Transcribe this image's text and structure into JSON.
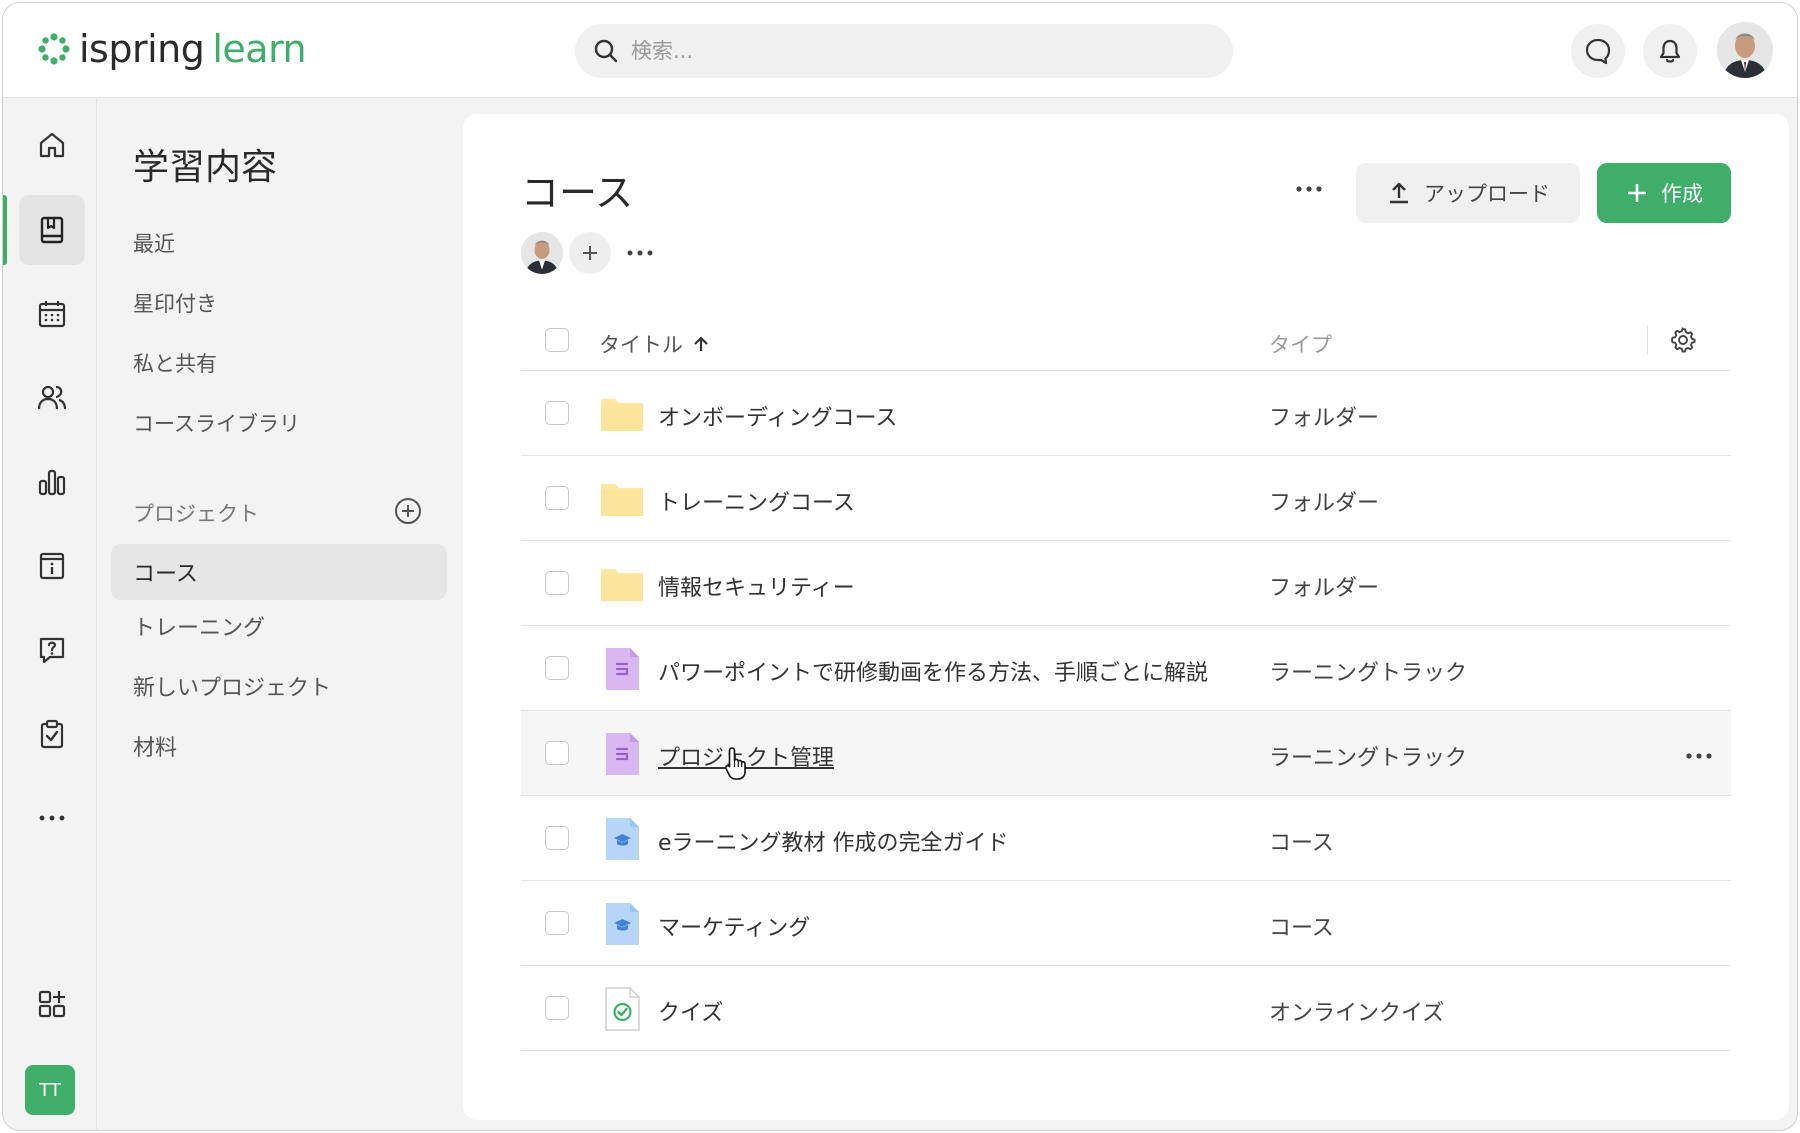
{
  "header": {
    "logo_primary": "ispring",
    "logo_secondary": "learn",
    "search_placeholder": "検索...",
    "colors": {
      "brand": "#3fae6b"
    }
  },
  "rail": {
    "items": [
      "home-icon",
      "book-icon",
      "calendar-icon",
      "users-icon",
      "chart-icon",
      "info-icon",
      "help-icon",
      "clipboard-check-icon",
      "more-icon",
      "apps-icon"
    ],
    "active": "book-icon",
    "user_initials": "TT"
  },
  "sidebar": {
    "title": "学習内容",
    "links": [
      "最近",
      "星印付き",
      "私と共有",
      "コースライブラリ"
    ],
    "section_label": "プロジェクト",
    "projects": [
      {
        "label": "コース",
        "active": true
      },
      {
        "label": "トレーニング",
        "active": false
      },
      {
        "label": "新しいプロジェクト",
        "active": false
      },
      {
        "label": "材料",
        "active": false
      }
    ]
  },
  "main": {
    "title": "コース",
    "upload_label": "アップロード",
    "create_label": "作成",
    "table": {
      "col_title": "タイトル",
      "col_type": "タイプ",
      "rows": [
        {
          "title": "オンボーディングコース",
          "type": "フォルダー",
          "icon": "folder-icon"
        },
        {
          "title": "トレーニングコース",
          "type": "フォルダー",
          "icon": "folder-icon"
        },
        {
          "title": "情報セキュリティー",
          "type": "フォルダー",
          "icon": "folder-icon"
        },
        {
          "title": "パワーポイントで研修動画を作る方法、手順ごとに解説",
          "type": "ラーニングトラック",
          "icon": "learning-track-icon"
        },
        {
          "title": "プロジェクト管理",
          "type": "ラーニングトラック",
          "icon": "learning-track-icon",
          "hovered": true
        },
        {
          "title": "eラーニング教材 作成の完全ガイド",
          "type": "コース",
          "icon": "course-icon"
        },
        {
          "title": "マーケティング",
          "type": "コース",
          "icon": "course-icon"
        },
        {
          "title": "クイズ",
          "type": "オンラインクイズ",
          "icon": "quiz-icon"
        }
      ]
    }
  }
}
